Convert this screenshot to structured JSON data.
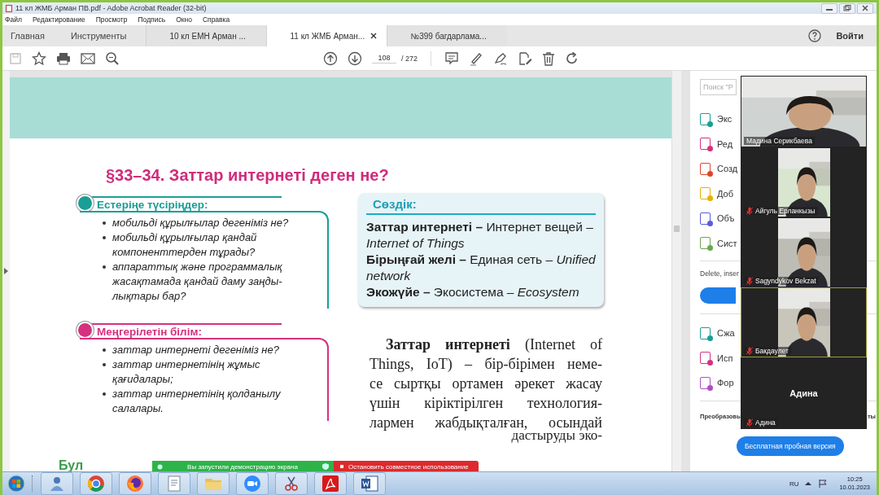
{
  "window": {
    "title": "11 кл ЖМБ Арман ПВ.pdf - Adobe Acrobat Reader (32-bit)"
  },
  "menu": [
    "Файл",
    "Редактирование",
    "Просмотр",
    "Подпись",
    "Окно",
    "Справка"
  ],
  "nav_tabs": [
    {
      "label": "Главная"
    },
    {
      "label": "Инструменты"
    }
  ],
  "doc_tabs": [
    {
      "label": "10 кл ЕМН Арман ...",
      "selected": false
    },
    {
      "label": "11 кл ЖМБ Арман...",
      "selected": true
    },
    {
      "label": "№399 багдарлама...",
      "selected": false
    }
  ],
  "sign_in": "Войти",
  "page_nav": {
    "current": "108",
    "total": "/ 272"
  },
  "document": {
    "heading": "§33–34. Заттар интернеті деген не?",
    "sections": [
      {
        "title": "Естеріңе түсіріңдер:",
        "color": "#1a9e95",
        "items": [
          "мобильді құрылғылар дегеніміз не?",
          "мобильді құрылғылар қандай компоненттерден тұрады?",
          "аппараттық және программалық жасақтамада қандай даму заңды-лықтары бар?"
        ]
      },
      {
        "title": "Меңгерілетін білім:",
        "color": "#d6317f",
        "items": [
          "заттар интернеті дегеніміз не?",
          "заттар интернетінің жұмыс қағидалары;",
          "заттар интернетінің қолданылу салалары."
        ]
      }
    ],
    "glossary": {
      "title": "Сөздік:",
      "entries": [
        "**Заттар интернеті –** Интернет вещей – *Internet of Things*",
        "**Бірыңғай желі –** Единая сеть – *Unified network*",
        "**Экожүйе –** Экосистема – *Ecosystem*"
      ]
    },
    "body_lines": [
      "**Заттар интернеті** (Internet of",
      "Things, IoT) – бір-бірімен неме-",
      "се сыртқы ортамен әрекет жасау",
      "үшін кіріктірілген технология-",
      "лармен жабдықталған, осындай"
    ],
    "cut_line": "дастыруды эко-",
    "next_heading": "Бул"
  },
  "tools_panel": {
    "search_placeholder": "Поиск \"Р",
    "tools": [
      "Экс",
      "Ред",
      "Созд",
      "Доб",
      "Объ",
      "Сист"
    ],
    "hint": "Delete, inser",
    "tools_more": [
      "Сжа",
      "Исп",
      "Фор"
    ],
    "convert_text": "Преобразовы",
    "convert_tail": "ты",
    "trial_button": "Бесплатная пробная версия"
  },
  "video": {
    "participants": [
      {
        "name": "Мадина Серикбаева",
        "kind": "featured",
        "video": true,
        "muted": false,
        "speaking": false
      },
      {
        "name": "Айгуль Ерланкызы",
        "kind": "thumbnail",
        "video": true,
        "muted": true,
        "speaking": false
      },
      {
        "name": "Sagyndykov Bekzat",
        "kind": "thumbnail",
        "video": true,
        "muted": true,
        "speaking": false
      },
      {
        "name": "Бакдаулет",
        "kind": "thumbnail",
        "video": true,
        "muted": true,
        "speaking": true
      },
      {
        "name": "Адина",
        "display_name": "Адина",
        "kind": "thumbnail",
        "video": false,
        "muted": true,
        "speaking": false
      }
    ]
  },
  "share_banner": {
    "status": "Вы запустили демонстрацию экрана",
    "stop_button": "Остановить совместное использование"
  },
  "taskbar": {
    "language": "RU",
    "time": "10:25",
    "date": "10.01.2023"
  }
}
